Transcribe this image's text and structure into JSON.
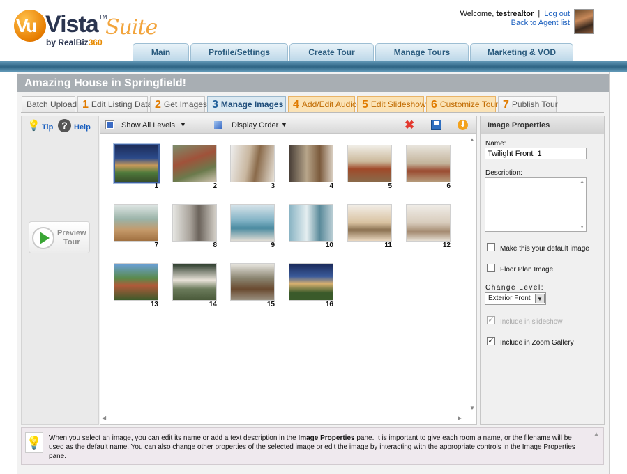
{
  "header": {
    "logo": {
      "vu": "Vu",
      "vista": "Vista",
      "tm": "TM",
      "suite": "Suite",
      "by": "by RealBiz",
      "by_num": "360"
    },
    "welcome_prefix": "Welcome,",
    "username": "testrealtor",
    "separator": "|",
    "logout": "Log out",
    "back_to_agents": "Back to Agent list"
  },
  "nav": {
    "tabs": [
      {
        "label": "Main"
      },
      {
        "label": "Profile/Settings"
      },
      {
        "label": "Create Tour"
      },
      {
        "label": "Manage Tours"
      },
      {
        "label": "Marketing & VOD"
      }
    ]
  },
  "page": {
    "title": "Amazing House in Springfield!"
  },
  "steps": [
    {
      "num": "",
      "label": "Batch Upload"
    },
    {
      "num": "1",
      "label": "Edit Listing Data"
    },
    {
      "num": "2",
      "label": "Get Images"
    },
    {
      "num": "3",
      "label": "Manage Images"
    },
    {
      "num": "4",
      "label": "Add/Edit Audio"
    },
    {
      "num": "5",
      "label": "Edit Slideshow"
    },
    {
      "num": "6",
      "label": "Customize Tour"
    },
    {
      "num": "7",
      "label": "Publish Tour"
    }
  ],
  "left": {
    "tip": "Tip",
    "help": "Help",
    "preview_line1": "Preview",
    "preview_line2": "Tour"
  },
  "toolbar": {
    "levels": "Show All Levels",
    "order": "Display Order"
  },
  "images": [
    "1",
    "2",
    "3",
    "4",
    "5",
    "6",
    "7",
    "8",
    "9",
    "10",
    "11",
    "12",
    "13",
    "14",
    "15",
    "16"
  ],
  "props": {
    "title": "Image Properties",
    "name_label": "Name:",
    "name_value": "Twilight Front  1",
    "desc_label": "Description:",
    "default_label": "Make this your default image",
    "floorplan_label": "Floor Plan Image",
    "level_label": "Change Level:",
    "level_value": "Exterior Front",
    "slideshow_label": "Include in slideshow",
    "zoom_label": "Include in Zoom Gallery",
    "slideshow_checked": true,
    "zoom_checked": true,
    "default_checked": false,
    "floorplan_checked": false
  },
  "tip": {
    "p1": "When you select an image, you can edit its name or add a text description in the ",
    "b1": "Image Properties",
    "p2": " pane. It is important to give each room a name, or the filename will be used as the default name. You can also change other properties of the selected image or edit the image by interacting with the appropriate controls in the Image Properties pane."
  },
  "colors": {
    "accent_orange": "#e07b00",
    "nav_blue": "#2f6585",
    "active_step": "#1f4d7a"
  }
}
